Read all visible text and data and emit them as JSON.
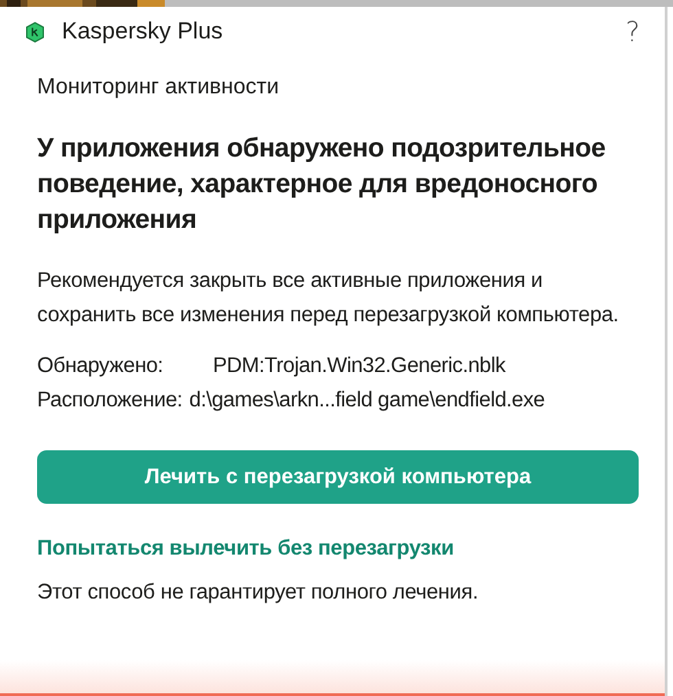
{
  "window": {
    "title": "Kaspersky Plus",
    "help": "?"
  },
  "section": "Мониторинг активности",
  "heading": "У приложения обнаружено подозрительное поведение, характерное для вредоносного приложения",
  "message": "Рекомендуется закрыть все активные приложения и сохранить все изменения перед перезагрузкой компьютера.",
  "details": [
    {
      "label": "Обнаружено:",
      "value": "PDM:Trojan.Win32.Generic.nblk"
    },
    {
      "label": "Расположение:",
      "value": "d:\\games\\arkn...field game\\endfield.exe"
    }
  ],
  "primary_button": "Лечить с перезагрузкой компьютера",
  "link": "Попытаться вылечить без перезагрузки",
  "note": "Этот способ не гарантирует полного лечения."
}
